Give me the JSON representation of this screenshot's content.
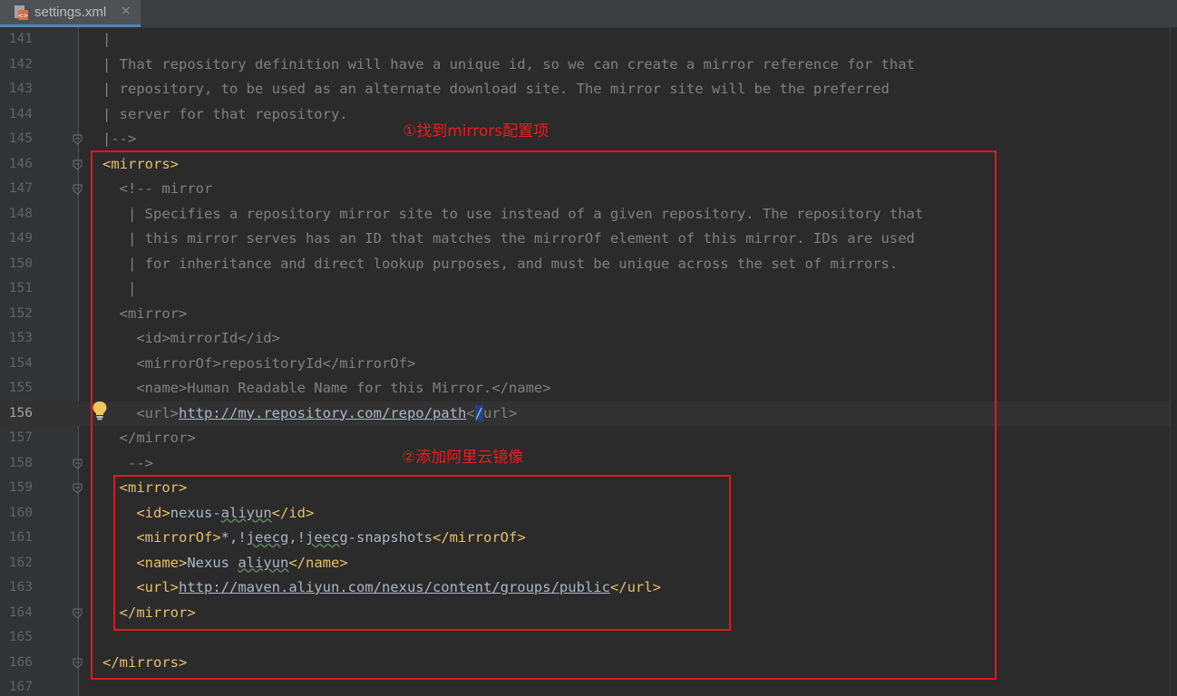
{
  "tab": {
    "file_name": "settings.xml",
    "file_icon": "xml-file-icon",
    "close_glyph": "×"
  },
  "editor": {
    "current_line": 156,
    "lines": [
      {
        "n": 141,
        "tokens": [
          {
            "t": "|",
            "c": "cm"
          }
        ]
      },
      {
        "n": 142,
        "tokens": [
          {
            "t": "| That repository definition will have a unique id, so we can create a mirror reference for that",
            "c": "cm"
          }
        ]
      },
      {
        "n": 143,
        "tokens": [
          {
            "t": "| repository, to be used as an alternate download site. The mirror site will be the preferred",
            "c": "cm"
          }
        ]
      },
      {
        "n": 144,
        "tokens": [
          {
            "t": "| server for that repository.",
            "c": "cm"
          }
        ]
      },
      {
        "n": 145,
        "tokens": [
          {
            "t": "|-->",
            "c": "cm"
          }
        ]
      },
      {
        "n": 146,
        "tokens": [
          {
            "t": "<mirrors>",
            "c": "tg"
          }
        ]
      },
      {
        "n": 147,
        "tokens": [
          {
            "t": "  <!-- mirror",
            "c": "cm"
          }
        ]
      },
      {
        "n": 148,
        "tokens": [
          {
            "t": "   | Specifies a repository mirror site to use instead of a given repository. The repository that",
            "c": "cm"
          }
        ]
      },
      {
        "n": 149,
        "tokens": [
          {
            "t": "   | this mirror serves has an ID that matches the mirrorOf element of this mirror. IDs are used",
            "c": "cm"
          }
        ]
      },
      {
        "n": 150,
        "tokens": [
          {
            "t": "   | for inheritance and direct lookup purposes, and must be unique across the set of mirrors.",
            "c": "cm"
          }
        ]
      },
      {
        "n": 151,
        "tokens": [
          {
            "t": "   |",
            "c": "cm"
          }
        ]
      },
      {
        "n": 152,
        "tokens": [
          {
            "t": "  <mirror>",
            "c": "cm"
          }
        ]
      },
      {
        "n": 153,
        "tokens": [
          {
            "t": "    <id>mirrorId</id>",
            "c": "cm"
          }
        ]
      },
      {
        "n": 154,
        "tokens": [
          {
            "t": "    <mirrorOf>repositoryId</mirrorOf>",
            "c": "cm"
          }
        ]
      },
      {
        "n": 155,
        "tokens": [
          {
            "t": "    <name>Human Readable Name for this Mirror.</name>",
            "c": "cm"
          }
        ]
      },
      {
        "n": 156,
        "tokens": [
          {
            "t": "    <url>",
            "c": "cm"
          },
          {
            "t": "http://my.repository.com/repo/path",
            "c": "lkg"
          },
          {
            "t": "<",
            "c": "cm"
          },
          {
            "t": "/",
            "c": "caret"
          },
          {
            "t": "url>",
            "c": "cm"
          }
        ]
      },
      {
        "n": 157,
        "tokens": [
          {
            "t": "  </mirror>",
            "c": "cm"
          }
        ]
      },
      {
        "n": 158,
        "tokens": [
          {
            "t": "   -->",
            "c": "cm"
          }
        ]
      },
      {
        "n": 159,
        "tokens": [
          {
            "t": "  <mirror>",
            "c": "tg"
          }
        ]
      },
      {
        "n": 160,
        "tokens": [
          {
            "t": "    <id>",
            "c": "tg"
          },
          {
            "t": "nexus-",
            "c": "tx"
          },
          {
            "t": "aliyun",
            "c": "sq"
          },
          {
            "t": "</id>",
            "c": "tg"
          }
        ]
      },
      {
        "n": 161,
        "tokens": [
          {
            "t": "    <mirrorOf>",
            "c": "tg"
          },
          {
            "t": "*,!",
            "c": "tx"
          },
          {
            "t": "jeecg",
            "c": "sq"
          },
          {
            "t": ",!",
            "c": "tx"
          },
          {
            "t": "jeecg",
            "c": "sq"
          },
          {
            "t": "-snapshots",
            "c": "tx"
          },
          {
            "t": "</mirrorOf>",
            "c": "tg"
          }
        ]
      },
      {
        "n": 162,
        "tokens": [
          {
            "t": "    <name>",
            "c": "tg"
          },
          {
            "t": "Nexus ",
            "c": "tx"
          },
          {
            "t": "aliyun",
            "c": "sq"
          },
          {
            "t": "</name>",
            "c": "tg"
          }
        ]
      },
      {
        "n": 163,
        "tokens": [
          {
            "t": "    <url>",
            "c": "tg"
          },
          {
            "t": "http://maven.aliyun.com/nexus/content/groups/public",
            "c": "lkg"
          },
          {
            "t": "</url>",
            "c": "tg"
          }
        ]
      },
      {
        "n": 164,
        "tokens": [
          {
            "t": "  </mirror>",
            "c": "tg"
          }
        ]
      },
      {
        "n": 165,
        "tokens": [
          {
            "t": "",
            "c": "tx"
          }
        ]
      },
      {
        "n": 166,
        "tokens": [
          {
            "t": "</mirrors>",
            "c": "tg"
          }
        ]
      },
      {
        "n": 167,
        "tokens": [
          {
            "t": "",
            "c": "tx"
          }
        ]
      }
    ],
    "fold_markers": [
      145,
      146,
      147,
      158,
      159,
      164,
      166
    ]
  },
  "annotations": {
    "step1": "①找到mirrors配置项",
    "step2": "②添加阿里云镜像"
  },
  "colors": {
    "annotation_red": "#e4161e",
    "tag": "#e8bf6a",
    "comment": "#808080",
    "text": "#a9b7c6",
    "background": "#2b2b2b"
  }
}
